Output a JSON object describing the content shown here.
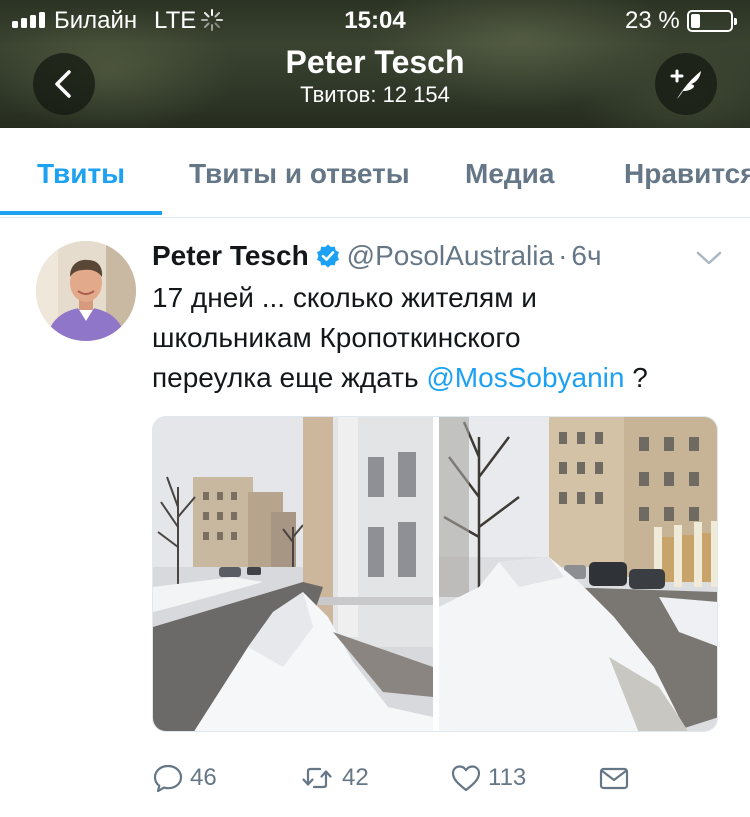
{
  "status_bar": {
    "carrier": "Билайн",
    "network": "LTE",
    "time": "15:04",
    "battery": "23 %",
    "battery_level": 0.23
  },
  "nav": {
    "title": "Peter Tesch",
    "subtitle": "Твитов: 12 154",
    "back_icon": "chevron-left-icon",
    "compose_icon": "compose-tweet-icon"
  },
  "tabs": [
    {
      "label": "Твиты",
      "active": true
    },
    {
      "label": "Твиты и ответы",
      "active": false
    },
    {
      "label": "Медиа",
      "active": false
    },
    {
      "label": "Нравится",
      "active": false
    }
  ],
  "tweet": {
    "author_name": "Peter Tesch",
    "verified": true,
    "handle": "@PosolAustralia",
    "dot": "·",
    "age": "6ч",
    "text_parts": {
      "line1": "17 дней ... сколько жителям и",
      "line2": "школьникам Кропоткинского",
      "line3_before": "переулка еще ждать ",
      "mention": "@MosSobyanin",
      "line3_after": " ?"
    },
    "media_count": 2,
    "actions": {
      "replies": "46",
      "retweets": "42",
      "likes": "113"
    }
  },
  "colors": {
    "accent": "#1da1f2",
    "secondary_text": "#657786",
    "verified_badge": "#1da1f2"
  }
}
